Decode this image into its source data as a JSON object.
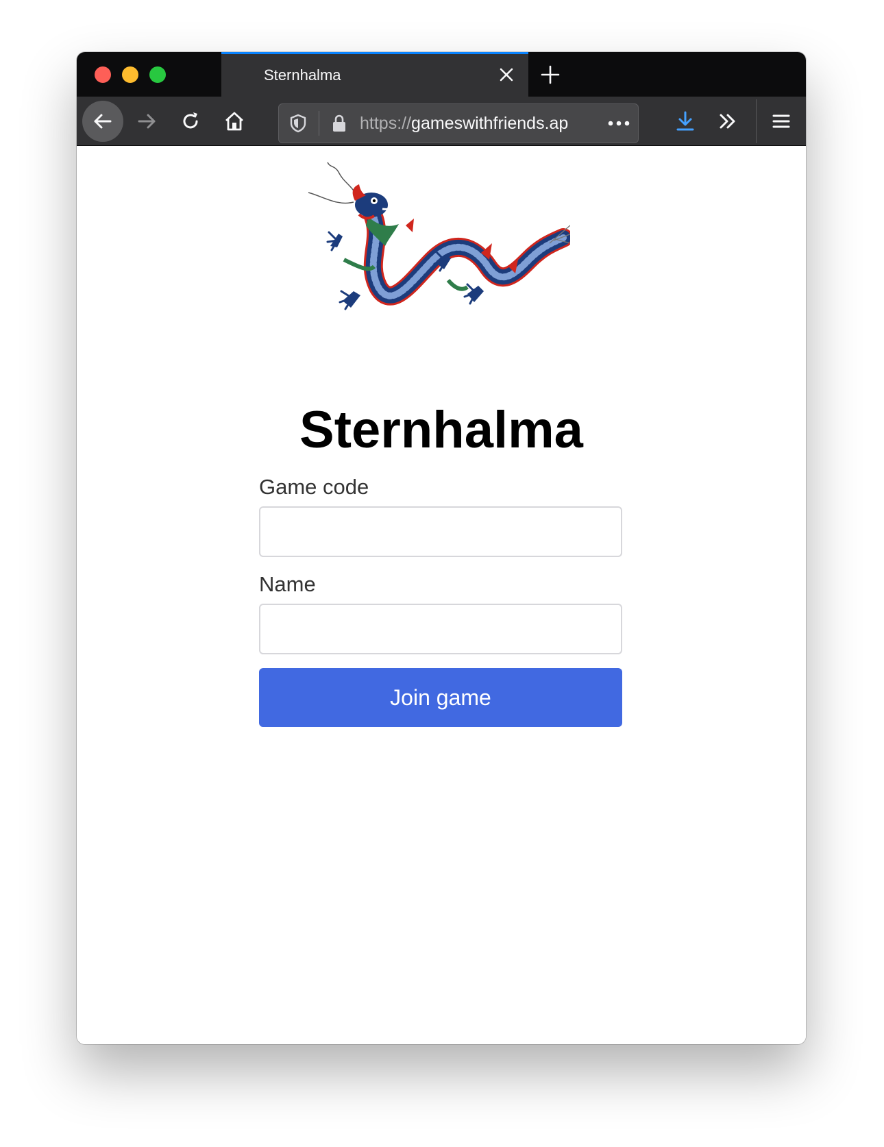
{
  "window": {
    "traffic_lights": [
      "close",
      "minimize",
      "zoom"
    ]
  },
  "tabs": [
    {
      "title": "Sternhalma",
      "active": true
    }
  ],
  "toolbar": {
    "url_scheme": "https://",
    "url_host": "gameswithfriends.ap",
    "icons": [
      "back-arrow-icon",
      "forward-arrow-icon",
      "reload-icon",
      "home-icon",
      "shield-icon",
      "lock-icon",
      "more-dots-icon",
      "download-icon",
      "overflow-chevrons-icon",
      "hamburger-menu-icon"
    ]
  },
  "page": {
    "title": "Sternhalma",
    "form": {
      "game_code_label": "Game code",
      "game_code_value": "",
      "name_label": "Name",
      "name_value": "",
      "submit_label": "Join game"
    }
  },
  "colors": {
    "accent_blue": "#4169e1",
    "tab_highlight": "#0a84ff",
    "download_icon": "#45a1ff",
    "dragon_blue": "#1c3c7c",
    "dragon_red": "#d0261d",
    "dragon_green": "#2f7d4a"
  }
}
